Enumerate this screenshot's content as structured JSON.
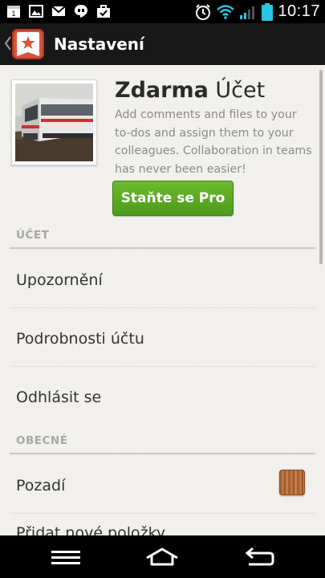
{
  "status_bar": {
    "time": "10:17",
    "left_icons": [
      "calendar-icon",
      "image-icon",
      "gmail-icon",
      "hangouts-icon",
      "briefcase-icon"
    ],
    "right_icons": [
      "alarm-icon",
      "wifi-icon",
      "signal-icon",
      "battery-icon"
    ],
    "accent_color": "#29c5e0"
  },
  "action_bar": {
    "title": "Nastavení",
    "app_icon": "wunderlist-star-icon",
    "brand_color": "#d9533b"
  },
  "account": {
    "plan_bold": "Zdarma",
    "plan_light": "Účet",
    "description": "Add comments and files to your to-dos and assign them to your colleagues. Collaboration in teams has never been easier!",
    "upgrade_label": "Staňte se Pro",
    "upgrade_color": "#5aa822"
  },
  "sections": [
    {
      "header": "ÚČET",
      "items": [
        {
          "label": "Upozornění"
        },
        {
          "label": "Podrobnosti účtu"
        },
        {
          "label": "Odhlásit se"
        }
      ]
    },
    {
      "header": "OBECNÉ",
      "items": [
        {
          "label": "Pozadí",
          "swatch": "wood-background-swatch"
        },
        {
          "label": "Přidat nové položky"
        }
      ]
    }
  ],
  "nav_bar": {
    "buttons": [
      "menu-icon",
      "home-icon",
      "back-icon"
    ]
  }
}
